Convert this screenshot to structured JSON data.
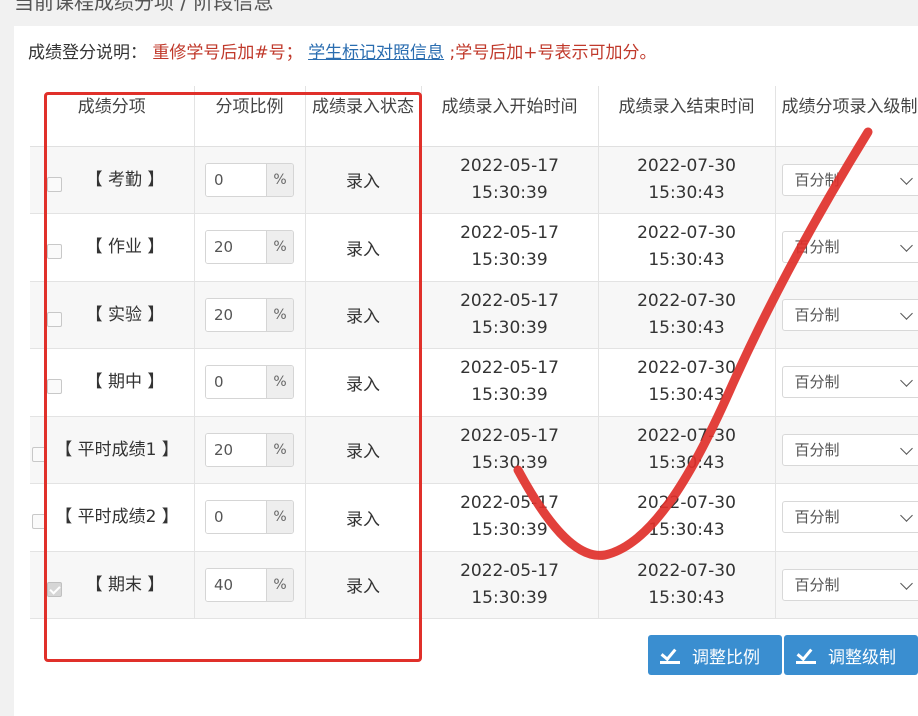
{
  "page_title": "当前课程成绩分项 / 阶段信息",
  "note": {
    "label": "成绩登分说明：",
    "retake": "重修学号后加#号；",
    "link": "学生标记对照信息",
    "plus": ";学号后加+号表示可加分。"
  },
  "table": {
    "headers": [
      "成绩分项",
      "分项比例",
      "成绩录入状态",
      "成绩录入开始时间",
      "成绩录入结束时间",
      "成绩分项录入级制"
    ],
    "rows": [
      {
        "name": "【 考勤 】",
        "ratio": "0",
        "unit": "%",
        "status": "录入",
        "start_date": "2022-05-17",
        "start_time": "15:30:39",
        "end_date": "2022-07-30",
        "end_time": "15:30:43",
        "scale": "百分制",
        "checked": false
      },
      {
        "name": "【 作业 】",
        "ratio": "20",
        "unit": "%",
        "status": "录入",
        "start_date": "2022-05-17",
        "start_time": "15:30:39",
        "end_date": "2022-07-30",
        "end_time": "15:30:43",
        "scale": "百分制",
        "checked": false
      },
      {
        "name": "【 实验 】",
        "ratio": "20",
        "unit": "%",
        "status": "录入",
        "start_date": "2022-05-17",
        "start_time": "15:30:39",
        "end_date": "2022-07-30",
        "end_time": "15:30:43",
        "scale": "百分制",
        "checked": false
      },
      {
        "name": "【 期中 】",
        "ratio": "0",
        "unit": "%",
        "status": "录入",
        "start_date": "2022-05-17",
        "start_time": "15:30:39",
        "end_date": "2022-07-30",
        "end_time": "15:30:43",
        "scale": "百分制",
        "checked": false
      },
      {
        "name": "【 平时成绩1 】",
        "ratio": "20",
        "unit": "%",
        "status": "录入",
        "start_date": "2022-05-17",
        "start_time": "15:30:39",
        "end_date": "2022-07-30",
        "end_time": "15:30:43",
        "scale": "百分制",
        "checked": false
      },
      {
        "name": "【 平时成绩2 】",
        "ratio": "0",
        "unit": "%",
        "status": "录入",
        "start_date": "2022-05-17",
        "start_time": "15:30:39",
        "end_date": "2022-07-30",
        "end_time": "15:30:43",
        "scale": "百分制",
        "checked": false
      },
      {
        "name": "【 期末 】",
        "ratio": "40",
        "unit": "%",
        "status": "录入",
        "start_date": "2022-05-17",
        "start_time": "15:30:39",
        "end_date": "2022-07-30",
        "end_time": "15:30:43",
        "scale": "百分制",
        "checked": true
      }
    ]
  },
  "buttons": {
    "adjust_ratio": "调整比例",
    "adjust_scale": "调整级制"
  },
  "colors": {
    "annotation": "#e0302a",
    "button": "#3a8ed0",
    "note_red": "#c0392b",
    "link": "#2a6db0"
  }
}
